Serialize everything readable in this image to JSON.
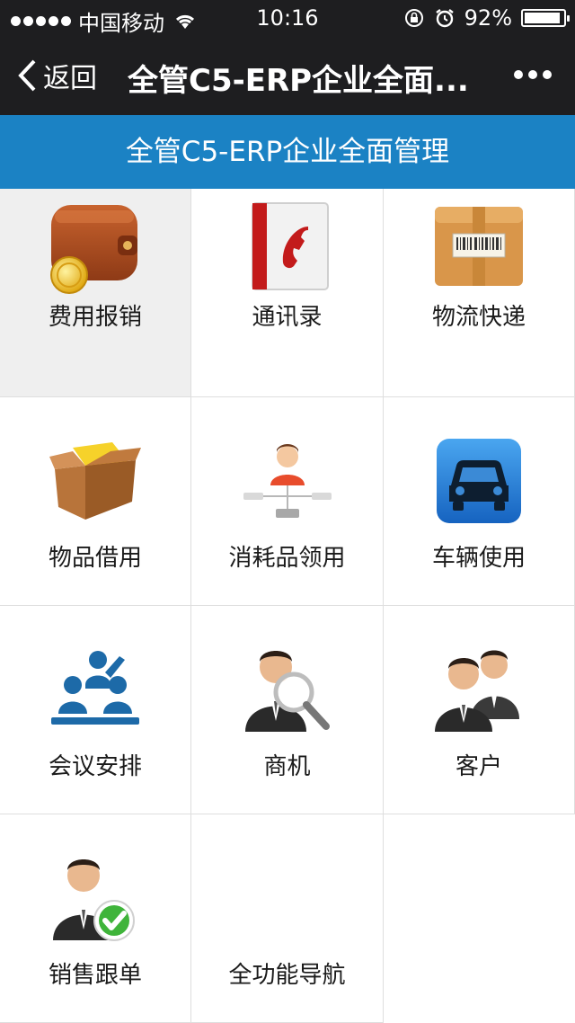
{
  "status_bar": {
    "carrier": "中国移动",
    "time": "10:16",
    "battery": "92%",
    "battery_level": 0.92,
    "icons": [
      "signal-icon",
      "wifi-icon",
      "rotation-lock-icon",
      "alarm-icon",
      "battery-icon"
    ]
  },
  "nav": {
    "back_label": "返回",
    "title": "全管C5-ERP企业全面...",
    "more_icon": "more-icon"
  },
  "header": {
    "title": "全管C5-ERP企业全面管理"
  },
  "grid": {
    "items": [
      {
        "label": "费用报销",
        "icon": "wallet-icon"
      },
      {
        "label": "通讯录",
        "icon": "contacts-book-icon"
      },
      {
        "label": "物流快递",
        "icon": "package-icon"
      },
      {
        "label": "物品借用",
        "icon": "open-box-icon"
      },
      {
        "label": "消耗品领用",
        "icon": "org-chart-icon"
      },
      {
        "label": "车辆使用",
        "icon": "car-icon"
      },
      {
        "label": "会议安排",
        "icon": "meeting-icon"
      },
      {
        "label": "商机",
        "icon": "business-search-icon"
      },
      {
        "label": "客户",
        "icon": "customers-icon"
      },
      {
        "label": "销售跟单",
        "icon": "sales-tracking-icon"
      },
      {
        "label": "全功能导航",
        "icon": ""
      }
    ]
  },
  "colors": {
    "status_bar_bg": "#1e1e20",
    "header_bg": "#1b82c4",
    "active_cell_bg": "#efefef",
    "grid_border": "#dedede"
  }
}
